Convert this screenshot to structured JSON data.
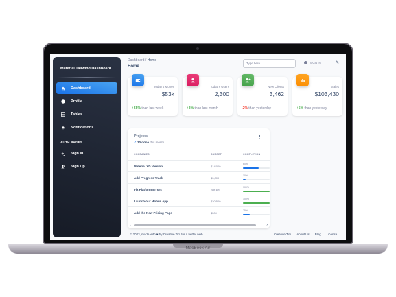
{
  "device": {
    "label": "MacBook Air"
  },
  "sidebar": {
    "brand": "Material Tailwind Dashboard",
    "items": [
      {
        "label": "Dashboard",
        "icon": "home-icon",
        "active": true
      },
      {
        "label": "Profile",
        "icon": "user-circle-icon"
      },
      {
        "label": "Tables",
        "icon": "table-icon"
      },
      {
        "label": "Notifications",
        "icon": "bell-icon"
      }
    ],
    "auth_title": "AUTH PAGES",
    "auth_items": [
      {
        "label": "Sign In",
        "icon": "sign-in-icon"
      },
      {
        "label": "Sign Up",
        "icon": "user-plus-icon"
      }
    ]
  },
  "navbar": {
    "breadcrumb": {
      "parent": "Dashboard",
      "separator": "/",
      "current": "Home"
    },
    "title": "Home",
    "search_placeholder": "Type here",
    "signin_label": "SIGN IN"
  },
  "stats": [
    {
      "label": "Today's Money",
      "value": "$53k",
      "change": "+55%",
      "change_text": "than last week",
      "trend": "up",
      "color": "#1a73e8",
      "icon": "wallet-icon"
    },
    {
      "label": "Today's Users",
      "value": "2,300",
      "change": "+3%",
      "change_text": "than last month",
      "trend": "up",
      "color": "#e91e63",
      "icon": "user-icon"
    },
    {
      "label": "New Clients",
      "value": "3,462",
      "change": "-2%",
      "change_text": "than yesterday",
      "trend": "down",
      "color": "#4caf50",
      "icon": "user-plus-icon"
    },
    {
      "label": "Sales",
      "value": "$103,430",
      "change": "+5%",
      "change_text": "than yesterday",
      "trend": "up",
      "color": "#fb8c00",
      "icon": "chart-icon"
    }
  ],
  "projects": {
    "title": "Projects",
    "subtitle_count": "30 done",
    "subtitle_text": "this month",
    "columns": [
      "COMPANIES",
      "BUDGET",
      "COMPLETION"
    ],
    "rows": [
      {
        "company": "Material XD Version",
        "budget": "$14,000",
        "completion": "60%",
        "progress": 0.6,
        "color": "#1a73e8"
      },
      {
        "company": "Add Progress Track",
        "budget": "$3,000",
        "completion": "10%",
        "progress": 0.1,
        "color": "#1a73e8"
      },
      {
        "company": "Fix Platform Errors",
        "budget": "Not set",
        "completion": "100%",
        "progress": 1.0,
        "color": "#4caf50"
      },
      {
        "company": "Launch our Mobile App",
        "budget": "$20,500",
        "completion": "100%",
        "progress": 1.0,
        "color": "#4caf50"
      },
      {
        "company": "Add the New Pricing Page",
        "budget": "$500",
        "completion": "25%",
        "progress": 0.25,
        "color": "#1a73e8"
      }
    ]
  },
  "footer": {
    "copyright": "© 2023, made with ♥ by Creative Tim for a better web.",
    "links": [
      "Creative Tim",
      "About Us",
      "Blog",
      "License"
    ]
  }
}
